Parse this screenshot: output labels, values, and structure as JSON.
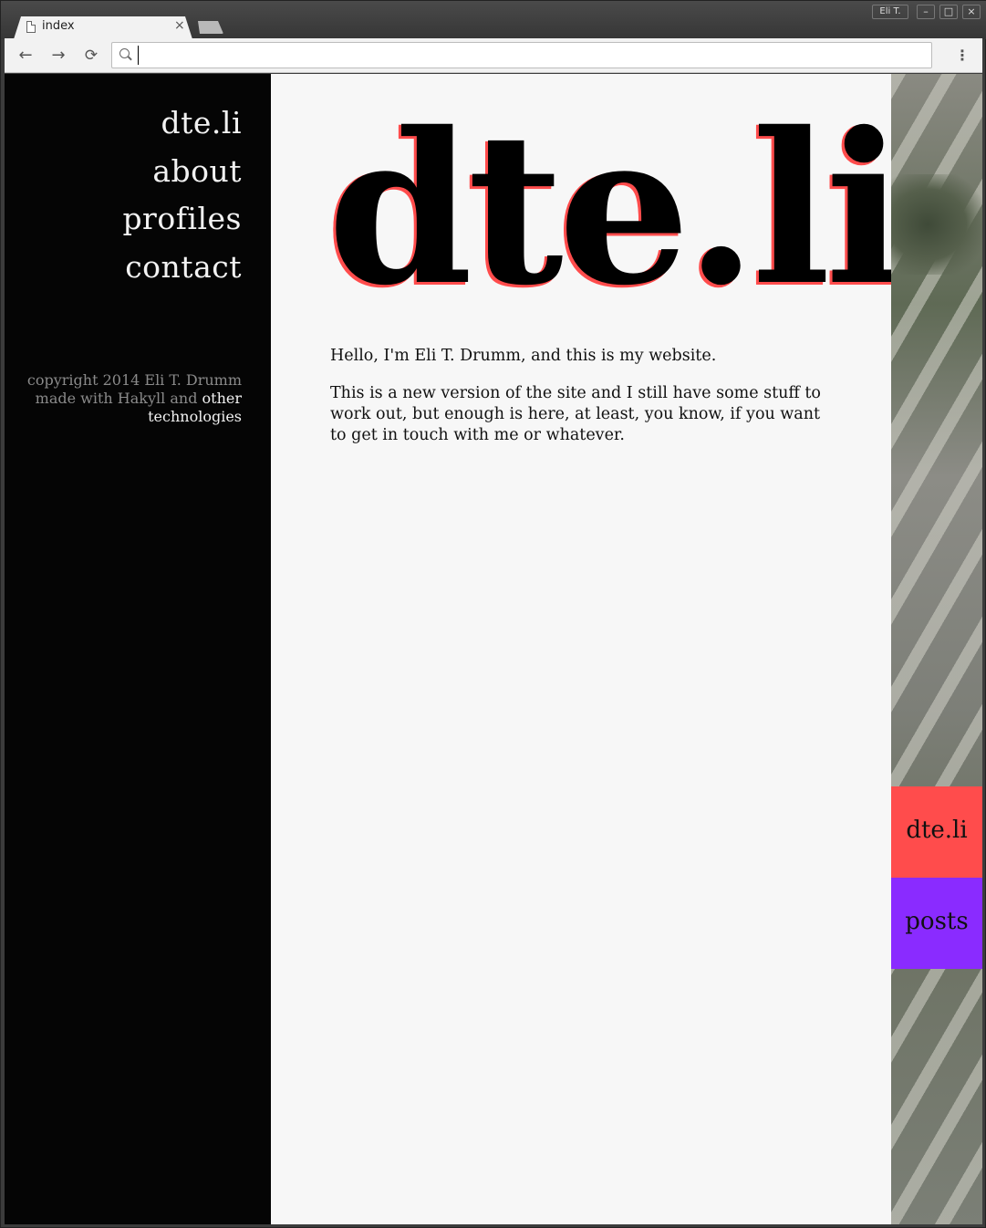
{
  "browser": {
    "tab_title": "index",
    "tab_close": "×",
    "user_badge": "Eli T.",
    "minimize": "–",
    "maximize": "□",
    "close": "×",
    "back": "←",
    "forward": "→",
    "reload": "⟳",
    "menu": "⋮",
    "address_value": ""
  },
  "sidebar": {
    "nav": [
      {
        "label": "dte.li"
      },
      {
        "label": "about"
      },
      {
        "label": "profiles"
      },
      {
        "label": "contact"
      }
    ],
    "footer": {
      "line1": "copyright 2014 Eli T. Drumm",
      "made_with": "made with Hakyll and ",
      "other_link": "other technologies"
    }
  },
  "main": {
    "title": "dte.li",
    "paragraphs": [
      "Hello, I'm Eli T. Drumm, and this is my website.",
      "This is a new version of the site and I still have some stuff to work out, but enough is here, at least, you know, if you want to get in touch with me or whatever."
    ]
  },
  "right_panel": {
    "tiles": [
      {
        "label": "dte.li",
        "color": "#ff4c4c"
      },
      {
        "label": "posts",
        "color": "#8a2bff"
      }
    ]
  },
  "colors": {
    "sidebar_bg": "#050505",
    "page_bg": "#f7f7f7",
    "title_shadow": "#ff4c4c"
  }
}
